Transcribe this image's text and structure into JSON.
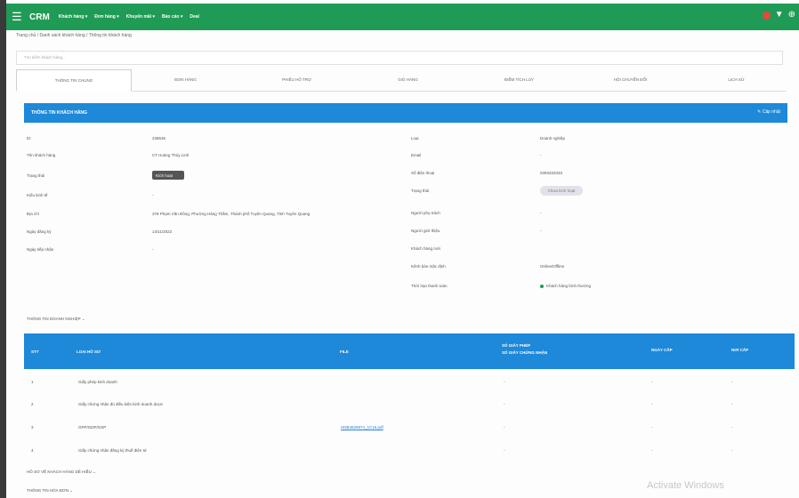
{
  "topbar": {
    "logo": "CRM",
    "menus": [
      "Khách hàng ▾",
      "Đơn hàng ▾",
      "Khuyến mãi ▾",
      "Báo cáo ▾",
      "Deal"
    ]
  },
  "breadcrumb": "Trang chủ / Danh sách khách hàng / Thông tin khách hàng",
  "search_placeholder": "Tìm kiếm khách hàng...",
  "tabs": [
    "THÔNG TIN CHUNG",
    "ĐƠN HÀNG",
    "PHIẾU HỖ TRỢ",
    "GIỎ HÀNG",
    "ĐIỂM TÍCH LŨY",
    "HỘI CHUYỂN ĐỔI",
    "LỊCH SỬ"
  ],
  "panel": {
    "title": "THÔNG TIN KHÁCH HÀNG",
    "edit": "✎ Cập nhật"
  },
  "left_fields": [
    {
      "label": "ID",
      "value": "238636"
    },
    {
      "label": "Tên khách hàng",
      "value": "CT Hoàng Thủy Linh"
    },
    {
      "label": "Trạng thái",
      "value": ""
    },
    {
      "label": "Kiểu kinh tế",
      "value": "-"
    },
    {
      "label": "Địa chỉ",
      "value": "378 Phạm Văn Đồng, Phường Hàng Thầm, Thành phố Tuyên Quang, Tỉnh Tuyên Quang"
    },
    {
      "label": "Ngày đăng ký",
      "value": "14/11/2022"
    },
    {
      "label": "Ngày tiếp nhận",
      "value": "-"
    }
  ],
  "status_value": "Kích hoạt",
  "right_fields": [
    {
      "label": "Loại",
      "value": "Doanh nghiệp"
    },
    {
      "label": "Email",
      "value": "-"
    },
    {
      "label": "Số điện thoại",
      "value": "0393333333"
    },
    {
      "label": "Trạng thái",
      "value": ""
    },
    {
      "label": "Người phụ trách",
      "value": "-"
    },
    {
      "label": "Người giới thiệu",
      "value": "-"
    },
    {
      "label": "Khách hàng mới",
      "value": ""
    },
    {
      "label": "Kênh bán mặc định",
      "value": "Online/Offline"
    },
    {
      "label": "Thời hạn thanh toán",
      "value": "Khách hàng bình thường"
    }
  ],
  "pill_value": "Chưa kích hoạt",
  "section_business": "THÔNG TIN DOANH NGHIỆP  ⌄",
  "table": {
    "headers": [
      "STT",
      "LOẠI HỒ SƠ",
      "FILE",
      "SỐ GIẤY PHÉP\nSỐ GIẤY CHỨNG NHẬN",
      "NGÀY CẤP",
      "NƠI CẤP"
    ],
    "rows": [
      {
        "stt": "1",
        "type": "Giấy phép kinh doanh",
        "file": "",
        "num": "-",
        "date": "-",
        "place": "-"
      },
      {
        "stt": "2",
        "type": "Giấy chứng nhận đủ điều kiện kinh doanh dược",
        "file": "",
        "num": "-",
        "date": "-",
        "place": "-"
      },
      {
        "stt": "3",
        "type": "GPP/GDP/GSP",
        "file": "HNB4829874_1C16.pdf",
        "num": "-",
        "date": "-",
        "place": "-"
      },
      {
        "stt": "4",
        "type": "Giấy chứng nhận đăng ký thuế điện tử",
        "file": "",
        "num": "-",
        "date": "-",
        "place": "-"
      }
    ]
  },
  "section_docs": "HỒ SƠ VỀ KHÁCH HÀNG DỄ HIỂU  ⌄",
  "section_tax": "THÔNG TIN HÓA ĐƠN  ⌄",
  "watermark": "Activate Windows"
}
